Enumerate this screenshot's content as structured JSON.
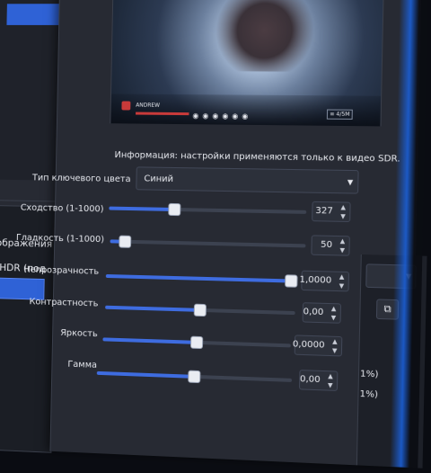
{
  "left_panel": {
    "items": [
      {
        "label": "изображения"
      },
      {
        "label": "ия HDR (под"
      }
    ]
  },
  "preview": {
    "player_name": "ANDREW",
    "hud_right": "≡ 4/5M"
  },
  "info_text": "Информация: настройки применяются только к видео SDR.",
  "key_color": {
    "label": "Тип ключевого цвета",
    "value": "Синий",
    "dropdown_icon": "chevron-down-icon"
  },
  "settings": [
    {
      "label": "Сходство (1-1000)",
      "value": "327",
      "fraction": 0.32
    },
    {
      "label": "Гладкость (1-1000)",
      "value": "50",
      "fraction": 0.05
    },
    {
      "label": "Непрозрачность",
      "value": "1,0000",
      "fraction": 1.0
    },
    {
      "label": "Контрастность",
      "value": "0,00",
      "fraction": 0.5
    },
    {
      "label": "Яркость",
      "value": "0,0000",
      "fraction": 0.5
    },
    {
      "label": "Гамма",
      "value": "0,00",
      "fraction": 0.5
    }
  ],
  "right_panel": {
    "percent_1": "1%)",
    "percent_2": "1%)"
  },
  "colors": {
    "accent": "#3e6ce0",
    "background": "#272a33",
    "selection": "#2f62d6"
  }
}
